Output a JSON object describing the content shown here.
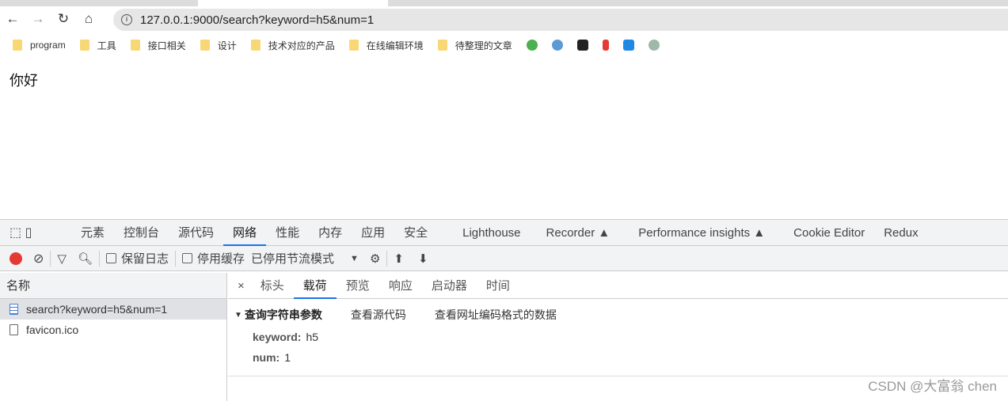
{
  "browser": {
    "url": "127.0.0.1:9000/search?keyword=h5&num=1",
    "bookmarks": [
      "program",
      "工具",
      "接口相关",
      "设计",
      "技术对应的产品",
      "在线编辑环境",
      "待整理的文章"
    ]
  },
  "page": {
    "text": "你好"
  },
  "devtools": {
    "tabs": [
      "元素",
      "控制台",
      "源代码",
      "网络",
      "性能",
      "内存",
      "应用",
      "安全",
      "Lighthouse",
      "Recorder ▲",
      "Performance insights ▲",
      "Cookie Editor",
      "Redux"
    ],
    "active_tab": "网络",
    "toolbar": {
      "preserve_log": "保留日志",
      "disable_cache": "停用缓存",
      "throttling": "已停用节流模式"
    },
    "name_header": "名称",
    "requests": [
      "search?keyword=h5&num=1",
      "favicon.ico"
    ],
    "detail_tabs": [
      "标头",
      "载荷",
      "预览",
      "响应",
      "启动器",
      "时间"
    ],
    "payload": {
      "section": "查询字符串参数",
      "view_source": "查看源代码",
      "view_url_encoded": "查看网址编码格式的数据",
      "params": [
        {
          "key": "keyword:",
          "value": "h5"
        },
        {
          "key": "num:",
          "value": "1"
        }
      ]
    }
  },
  "watermark": "CSDN @大富翁 chen",
  "colors": {
    "accent": "#1a73e8",
    "record": "#e53935"
  }
}
